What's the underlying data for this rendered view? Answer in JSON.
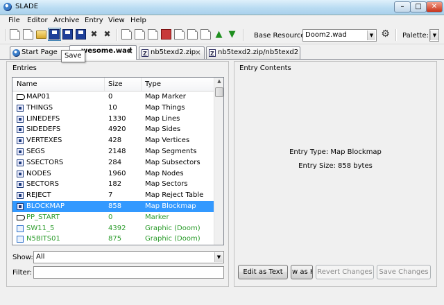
{
  "window": {
    "title": "SLADE",
    "controls": [
      "minimize",
      "maximize",
      "close"
    ]
  },
  "menu": [
    {
      "label": "File",
      "key": "F"
    },
    {
      "label": "Editor",
      "key": "E"
    },
    {
      "label": "Archive",
      "key": "A"
    },
    {
      "label": "Entry",
      "key": "E"
    },
    {
      "label": "View",
      "key": "V"
    },
    {
      "label": "Help",
      "key": "H"
    }
  ],
  "toolbar": {
    "base_resource_label": "Base Resource:",
    "base_resource_value": "Doom2.wad",
    "palette_label": "Palette:",
    "tooltip": "Save"
  },
  "tabs": [
    {
      "label": "Start Page"
    },
    {
      "label": "wesome.wad"
    },
    {
      "label": "nb5texd2.zip"
    },
    {
      "label": "nb5texd2.zip/nb5texd2"
    }
  ],
  "entries": {
    "group_title": "Entries",
    "columns": {
      "name": "Name",
      "size": "Size",
      "type": "Type"
    },
    "rows": [
      {
        "name": "MAP01",
        "size": "0",
        "type": "Map Marker",
        "icon": "marker-icon"
      },
      {
        "name": "THINGS",
        "size": "10",
        "type": "Map Things",
        "icon": "map-data-icon"
      },
      {
        "name": "LINEDEFS",
        "size": "1330",
        "type": "Map Lines",
        "icon": "map-data-icon"
      },
      {
        "name": "SIDEDEFS",
        "size": "4920",
        "type": "Map Sides",
        "icon": "map-data-icon"
      },
      {
        "name": "VERTEXES",
        "size": "428",
        "type": "Map Vertices",
        "icon": "map-data-icon"
      },
      {
        "name": "SEGS",
        "size": "2148",
        "type": "Map Segments",
        "icon": "map-data-icon"
      },
      {
        "name": "SSECTORS",
        "size": "284",
        "type": "Map Subsectors",
        "icon": "map-data-icon"
      },
      {
        "name": "NODES",
        "size": "1960",
        "type": "Map Nodes",
        "icon": "map-data-icon"
      },
      {
        "name": "SECTORS",
        "size": "182",
        "type": "Map Sectors",
        "icon": "map-data-icon"
      },
      {
        "name": "REJECT",
        "size": "7",
        "type": "Map Reject Table",
        "icon": "map-data-icon"
      },
      {
        "name": "BLOCKMAP",
        "size": "858",
        "type": "Map Blockmap",
        "icon": "map-data-icon"
      },
      {
        "name": "PP_START",
        "size": "0",
        "type": "Marker",
        "icon": "marker-icon"
      },
      {
        "name": "SW11_5",
        "size": "4392",
        "type": "Graphic (Doom)",
        "icon": "graphic-icon"
      },
      {
        "name": "N5BITS01",
        "size": "875",
        "type": "Graphic (Doom)",
        "icon": "graphic-icon"
      }
    ],
    "selected_index": 10,
    "show_label": "Show:",
    "show_value": "All",
    "filter_label": "Filter:",
    "filter_value": ""
  },
  "contents": {
    "group_title": "Entry Contents",
    "entry_type": "Entry Type: Map Blockmap",
    "entry_size": "Entry Size: 858 bytes",
    "buttons": {
      "edit_as_text": "Edit as Text",
      "view_as_hex": "w as H",
      "revert": "Revert Changes",
      "save": "Save Changes"
    }
  },
  "colors": {
    "selection": "#3399ff",
    "green_text": "#2a9b2a"
  }
}
